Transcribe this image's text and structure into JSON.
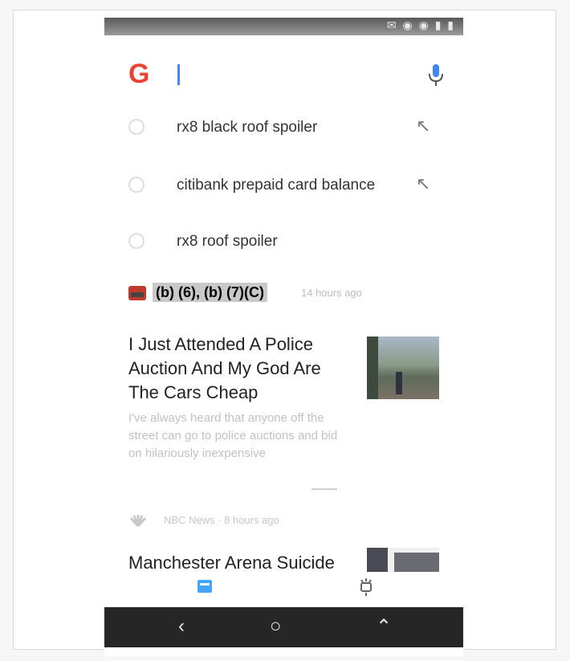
{
  "search": {
    "logo": "G",
    "query": ""
  },
  "suggestions": [
    {
      "text": "rx8 black roof spoiler",
      "arrow": "↖"
    },
    {
      "text": "citibank prepaid card balance",
      "arrow": "↖"
    },
    {
      "text": "rx8 roof spoiler",
      "arrow": ""
    }
  ],
  "feed": {
    "card1": {
      "source_redacted": "(b) (6), (b) (7)(C)",
      "time": "14 hours ago",
      "headline": "I Just Attended A Police Auction And My God Are The Cars Cheap",
      "snippet": "I've always heard that anyone off the street can go to police auctions and bid on hilariously inexpensive"
    },
    "card2": {
      "source": "NBC News · 8 hours ago",
      "headline": "Manchester Arena Suicide"
    }
  },
  "system_nav": {
    "back": "‹",
    "home": "○",
    "recents": "⌃"
  },
  "colors": {
    "accent": "#42a5f5",
    "caret": "#4285f4",
    "google_red": "#ea4335",
    "redaction": "#c9c9c9"
  }
}
